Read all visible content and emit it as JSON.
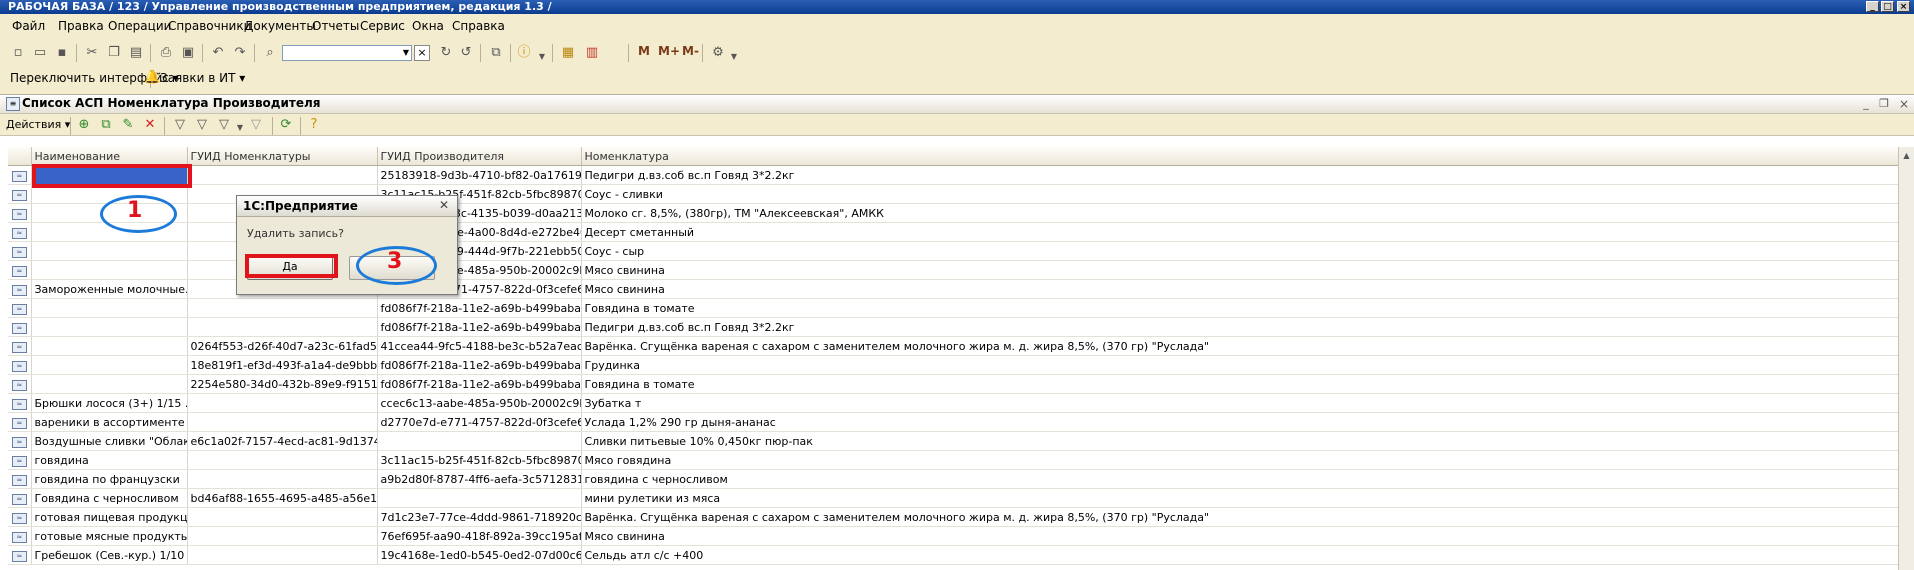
{
  "window": {
    "title": "РАБОЧАЯ БАЗА / 123 /  Управление производственным предприятием, редакция 1.3 /"
  },
  "menu": [
    "Файл",
    "Правка",
    "Операции",
    "Справочники",
    "Документы",
    "Отчеты",
    "Сервис",
    "Окна",
    "Справка"
  ],
  "toolbar": {
    "m_buttons": [
      "M",
      "M+",
      "M-"
    ]
  },
  "interface_bar": {
    "switch_label": "Переключить интерфейс ▾",
    "tickets_label": "Заявки в ИТ ▾"
  },
  "form": {
    "title": "Список АСП Номенклатура Производителя",
    "actions_label": "Действия ▾"
  },
  "grid": {
    "columns": [
      "Наименование",
      "ГУИД Номенклатуры",
      "ГУИД Производителя",
      "Номенклатура"
    ],
    "rows": [
      [
        "",
        "",
        "25183918-9d3b-4710-bf82-0a176191c...",
        "Педигри д.вз.соб вс.п Говяд 3*2.2кг"
      ],
      [
        "",
        "",
        "3c11ac15-b25f-451f-82cb-5fbc898703...",
        "Соус - сливки"
      ],
      [
        "",
        "",
        "1d9a2b17-7a3c-4135-b039-d0aa2139...",
        "Молоко сг. 8,5%,  (380гр),   ТМ \"Алексеевская\", АМКК"
      ],
      [
        "",
        "",
        "8fe5c402-0d7e-4a00-8d4d-e272be408...",
        "Десерт сметанный"
      ],
      [
        "",
        "",
        "4a80fe31-22c9-444d-9f7b-221ebb506c...",
        "Соус - сыр"
      ],
      [
        "",
        "",
        "ccec6c13-aabe-485a-950b-20002c9b...",
        "Мясо свинина"
      ],
      [
        "Замороженные молочные...",
        "",
        "d2770e7d-e771-4757-822d-0f3cefe61...",
        "Мясо свинина"
      ],
      [
        "",
        "",
        "fd086f7f-218a-11e2-a69b-b499babae7...",
        "Говядина в томате"
      ],
      [
        "",
        "",
        "fd086f7f-218a-11e2-a69b-b499babae7...",
        "Педигри д.вз.соб вс.п Говяд 3*2.2кг"
      ],
      [
        "",
        "0264f553-d26f-40d7-a23c-61fad5fe...",
        "41ccea44-9fc5-4188-be3c-b52a7eac5...",
        "Варёнка. Сгущёнка вареная с сахаром с заменителем молочного жира м. д. жира 8,5%, (370 гр) \"Руслада\""
      ],
      [
        "",
        "18e819f1-ef3d-493f-a1a4-de9bbb7c...",
        "fd086f7f-218a-11e2-a69b-b499babae7...",
        "Грудинка"
      ],
      [
        "",
        "2254e580-34d0-432b-89e9-f915118...",
        "fd086f7f-218a-11e2-a69b-b499babae7...",
        "Говядина в томате"
      ],
      [
        "Брюшки лосося (3+) 1/15 ...",
        "",
        "ccec6c13-aabe-485a-950b-20002c9b...",
        "Зубатка т"
      ],
      [
        "вареники в ассортименте ...",
        "",
        "d2770e7d-e771-4757-822d-0f3cefe61...",
        "Услада 1,2% 290 гр дыня-ананас"
      ],
      [
        "Воздушные сливки \"Облак...",
        "e6c1a02f-7157-4ecd-ac81-9d1374d...",
        "",
        "Сливки питьевые 10% 0,450кг пюр-пак"
      ],
      [
        "говядина",
        "",
        "3c11ac15-b25f-451f-82cb-5fbc898703...",
        "Мясо говядина"
      ],
      [
        "говядина по французски",
        "",
        "a9b2d80f-8787-4ff6-aefa-3c5712831cca",
        "говядина с черносливом"
      ],
      [
        "Говядина с черносливом",
        "bd46af88-1655-4695-a485-a56e108...",
        "",
        "мини рулетики из мяса"
      ],
      [
        "готовая пищевая продукц...",
        "",
        "7d1c23e7-77ce-4ddd-9861-718920cfe...",
        "Варёнка. Сгущёнка вареная с сахаром с заменителем молочного жира м. д. жира 8,5%, (370 гр) \"Руслада\""
      ],
      [
        "готовые мясные продукты...",
        "",
        "76ef695f-aa90-418f-892a-39cc195afd11",
        "Мясо свинина"
      ],
      [
        "Гребешок (Сев.-кур.) 1/10 ...",
        "",
        "19c4168e-1ed0-b545-0ed2-07d00c60...",
        "Сельдь атл с/с +400"
      ]
    ]
  },
  "dialog": {
    "title": "1С:Предприятие",
    "message": "Удалить запись?",
    "yes_label": "Да",
    "no_label": ""
  },
  "annotations": {
    "mark_1": "1",
    "mark_3": "3"
  }
}
